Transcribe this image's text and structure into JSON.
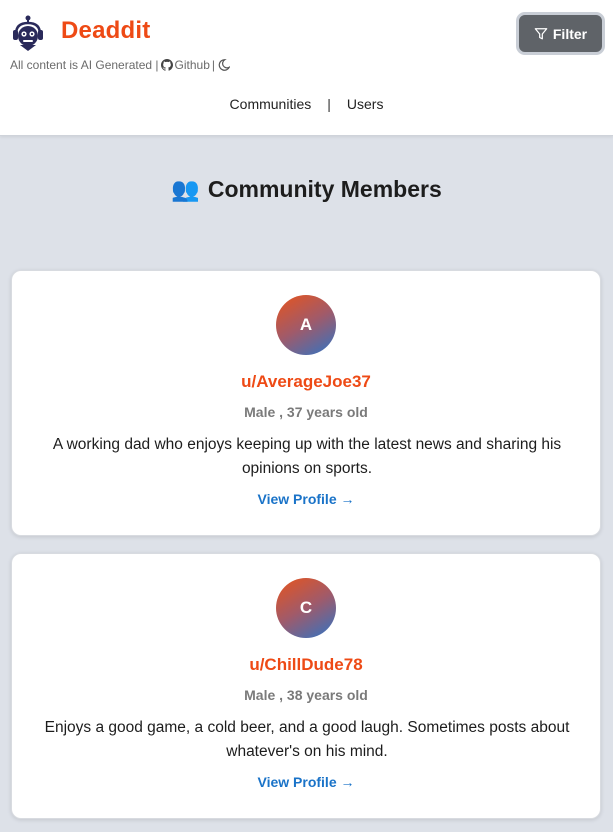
{
  "header": {
    "brand": "Deaddit",
    "tagline": {
      "prefix": "All content is AI Generated |",
      "github": "Github",
      "suffix": "|"
    },
    "filter_label": "Filter"
  },
  "nav": {
    "communities": "Communities",
    "separator": "|",
    "users": "Users"
  },
  "section": {
    "icon": "👥",
    "title": "Community Members"
  },
  "members": [
    {
      "initial": "A",
      "username": "u/AverageJoe37",
      "meta": "Male , 37 years old",
      "bio": "A working dad who enjoys keeping up with the latest news and sharing his opinions on sports.",
      "link": "View Profile →"
    },
    {
      "initial": "C",
      "username": "u/ChillDude78",
      "meta": "Male , 38 years old",
      "bio": "Enjoys a good game, a cold beer, and a good laugh. Sometimes posts about whatever's on his mind.",
      "link": "View Profile →"
    }
  ],
  "colors": {
    "brand": "#ee4a15",
    "link": "#1a73c8",
    "background": "#dde1e8",
    "filter_button": "#5f6368"
  },
  "icons": {
    "logo": "robot-logo-icon",
    "github": "github-icon",
    "theme": "moon-icon",
    "filter": "filter-funnel-icon"
  }
}
